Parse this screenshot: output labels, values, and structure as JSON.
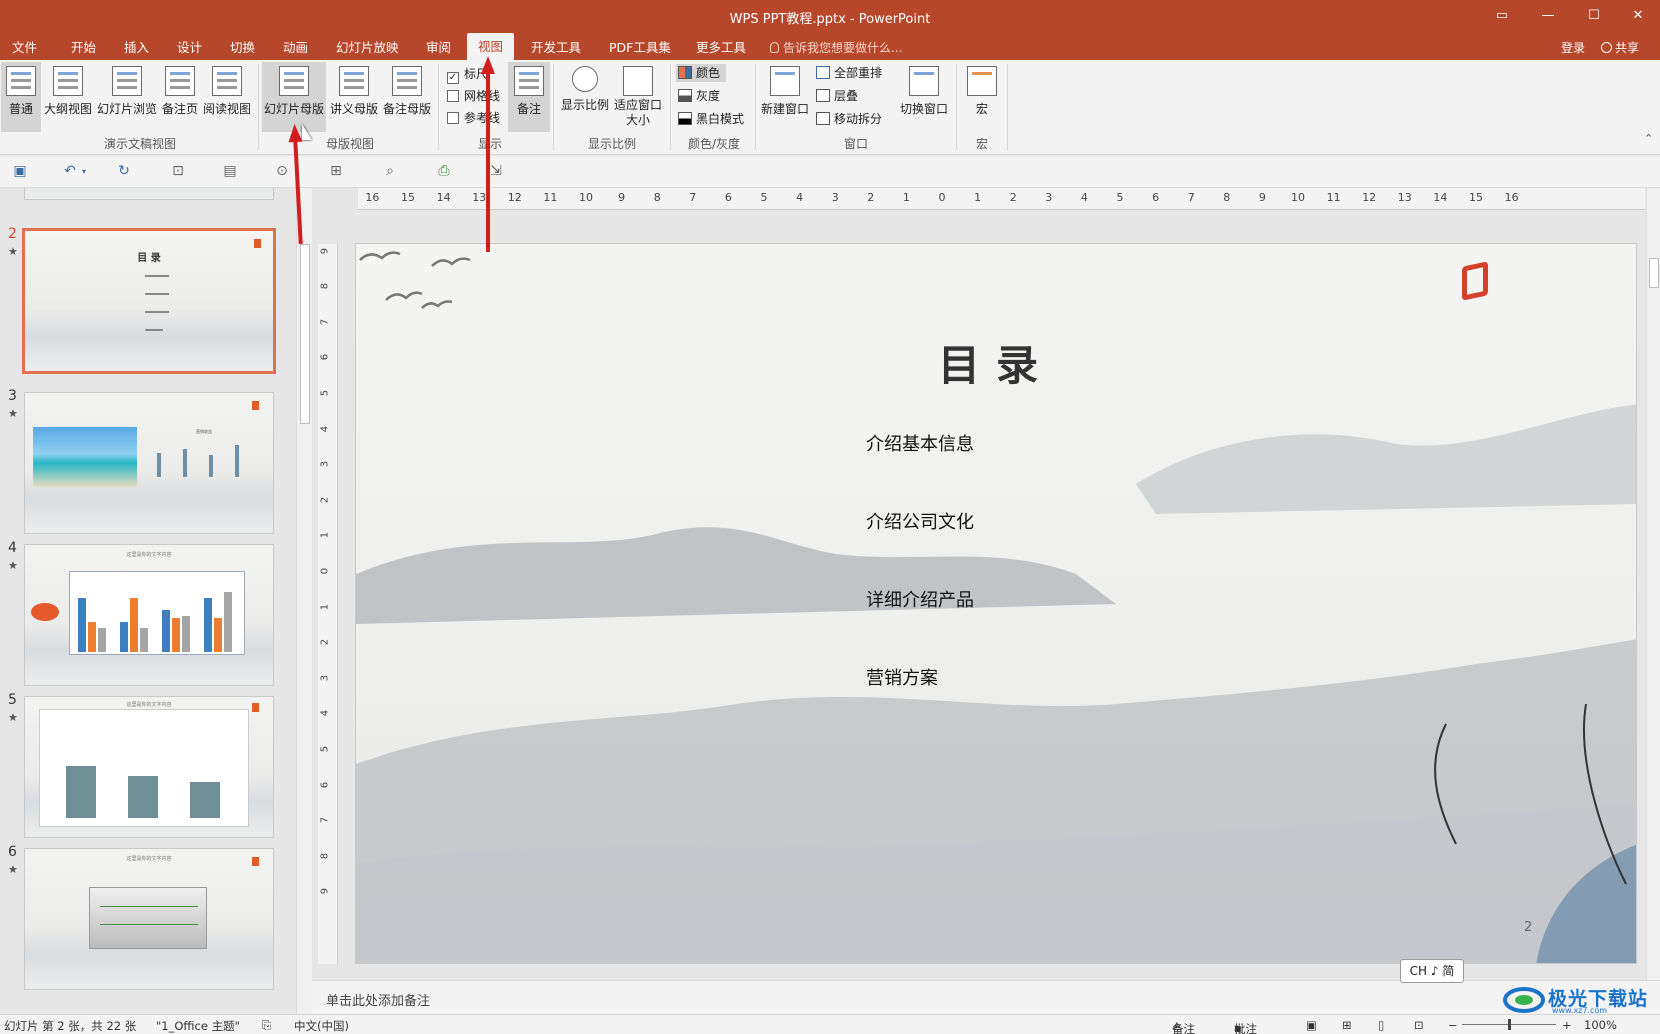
{
  "window": {
    "title": "WPS PPT教程.pptx - PowerPoint"
  },
  "tabs": [
    "文件",
    "开始",
    "插入",
    "设计",
    "切换",
    "动画",
    "幻灯片放映",
    "审阅",
    "视图",
    "开发工具",
    "PDF工具集",
    "更多工具"
  ],
  "active_tab": "视图",
  "tell_me": "告诉我您想要做什么...",
  "account": {
    "login": "登录",
    "share": "共享"
  },
  "ribbon": {
    "presentation_views": {
      "label": "演示文稿视图",
      "buttons": [
        "普通",
        "大纲视图",
        "幻灯片浏览",
        "备注页",
        "阅读视图"
      ]
    },
    "master_views": {
      "label": "母版视图",
      "buttons": [
        "幻灯片母版",
        "讲义母版",
        "备注母版"
      ]
    },
    "show": {
      "label": "显示",
      "checks": [
        {
          "label": "标尺",
          "checked": true
        },
        {
          "label": "网格线",
          "checked": false
        },
        {
          "label": "参考线",
          "checked": false
        }
      ],
      "notes_button": "备注"
    },
    "zoom": {
      "label": "显示比例",
      "zoom_button": "显示比例",
      "fit_button": "适应窗口大小"
    },
    "color": {
      "label": "颜色/灰度",
      "items": [
        "颜色",
        "灰度",
        "黑白模式"
      ]
    },
    "window": {
      "label": "窗口",
      "new_window": "新建窗口",
      "items": [
        "全部重排",
        "层叠",
        "移动拆分"
      ],
      "switch": "切换窗口"
    },
    "macros": {
      "label": "宏",
      "button": "宏"
    }
  },
  "thumbnails": [
    {
      "num": "2",
      "star": "★",
      "title": "目 录"
    },
    {
      "num": "3",
      "star": "★",
      "title": "营销收益"
    },
    {
      "num": "4",
      "star": "★",
      "title": "这里是你的文字内容"
    },
    {
      "num": "5",
      "star": "★",
      "title": "这里是你的文字内容"
    },
    {
      "num": "6",
      "star": "★",
      "title": "这里是你的文字内容"
    }
  ],
  "slide": {
    "title": "目录",
    "items": [
      "介绍基本信息",
      "介绍公司文化",
      "详细介绍产品",
      "营销方案"
    ],
    "number": "2"
  },
  "notes_placeholder": "单击此处添加备注",
  "ime": "CH ♪ 简",
  "status": {
    "slide_info": "幻灯片 第 2 张，共 22 张",
    "theme": "\"1_Office 主题\"",
    "language": "中文(中国)",
    "notes": "备注",
    "comments": "批注",
    "zoom": "100%"
  },
  "watermark": {
    "text": "极光下载站",
    "sub": "www.xz7.com"
  },
  "colors": {
    "accent": "#b7472a",
    "ribbon_bg": "#f3f3f3",
    "selected_thumb": "#e4704f",
    "annotation_arrow": "#d01f1f"
  }
}
